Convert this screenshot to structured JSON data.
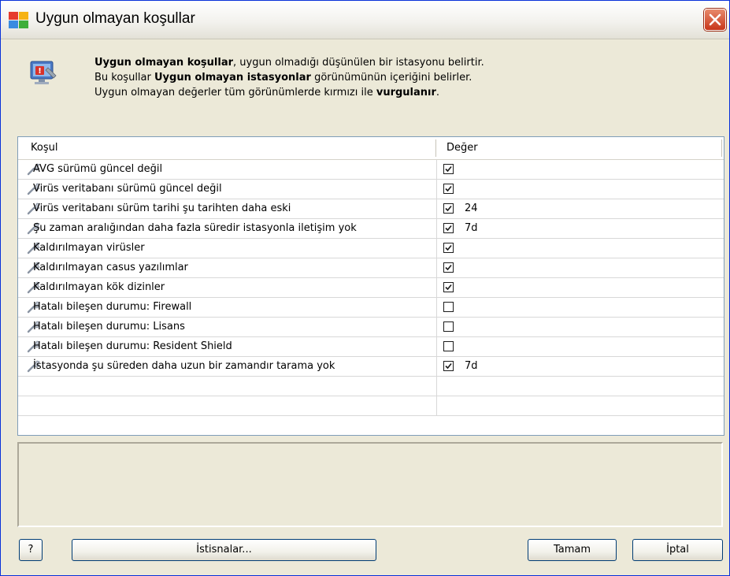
{
  "window": {
    "title": "Uygun olmayan koşullar"
  },
  "header": {
    "line1_bold": "Uygun olmayan koşullar",
    "line1_rest": ", uygun olmadığı düşünülen bir istasyonu belirtir.",
    "line2_a": "Bu koşullar ",
    "line2_bold": "Uygun olmayan istasyonlar",
    "line2_b": " görünümünün içeriğini belirler.",
    "line3_a": "Uygun olmayan değerler tüm görünümlerde kırmızı ile ",
    "line3_bold": "vurgulanır",
    "line3_b": "."
  },
  "grid": {
    "columns": [
      "Koşul",
      "Değer"
    ],
    "rows": [
      {
        "label": "AVG sürümü güncel değil",
        "checked": true,
        "value": ""
      },
      {
        "label": "Virüs veritabanı sürümü güncel değil",
        "checked": true,
        "value": ""
      },
      {
        "label": "Virüs veritabanı sürüm tarihi şu tarihten daha eski",
        "checked": true,
        "value": "24"
      },
      {
        "label": "Şu zaman aralığından daha fazla süredir istasyonla iletişim yok",
        "checked": true,
        "value": "7d"
      },
      {
        "label": "Kaldırılmayan virüsler",
        "checked": true,
        "value": ""
      },
      {
        "label": "Kaldırılmayan casus yazılımlar",
        "checked": true,
        "value": ""
      },
      {
        "label": "Kaldırılmayan kök dizinler",
        "checked": true,
        "value": ""
      },
      {
        "label": "Hatalı bileşen durumu: Firewall",
        "checked": false,
        "value": ""
      },
      {
        "label": "Hatalı bileşen durumu: Lisans",
        "checked": false,
        "value": ""
      },
      {
        "label": "Hatalı bileşen durumu: Resident Shield",
        "checked": false,
        "value": ""
      },
      {
        "label": "İstasyonda şu süreden daha uzun bir zamandır tarama yok",
        "checked": true,
        "value": "7d"
      }
    ]
  },
  "buttons": {
    "help": "?",
    "exceptions": "İstisnalar...",
    "ok": "Tamam",
    "cancel": "İptal"
  }
}
